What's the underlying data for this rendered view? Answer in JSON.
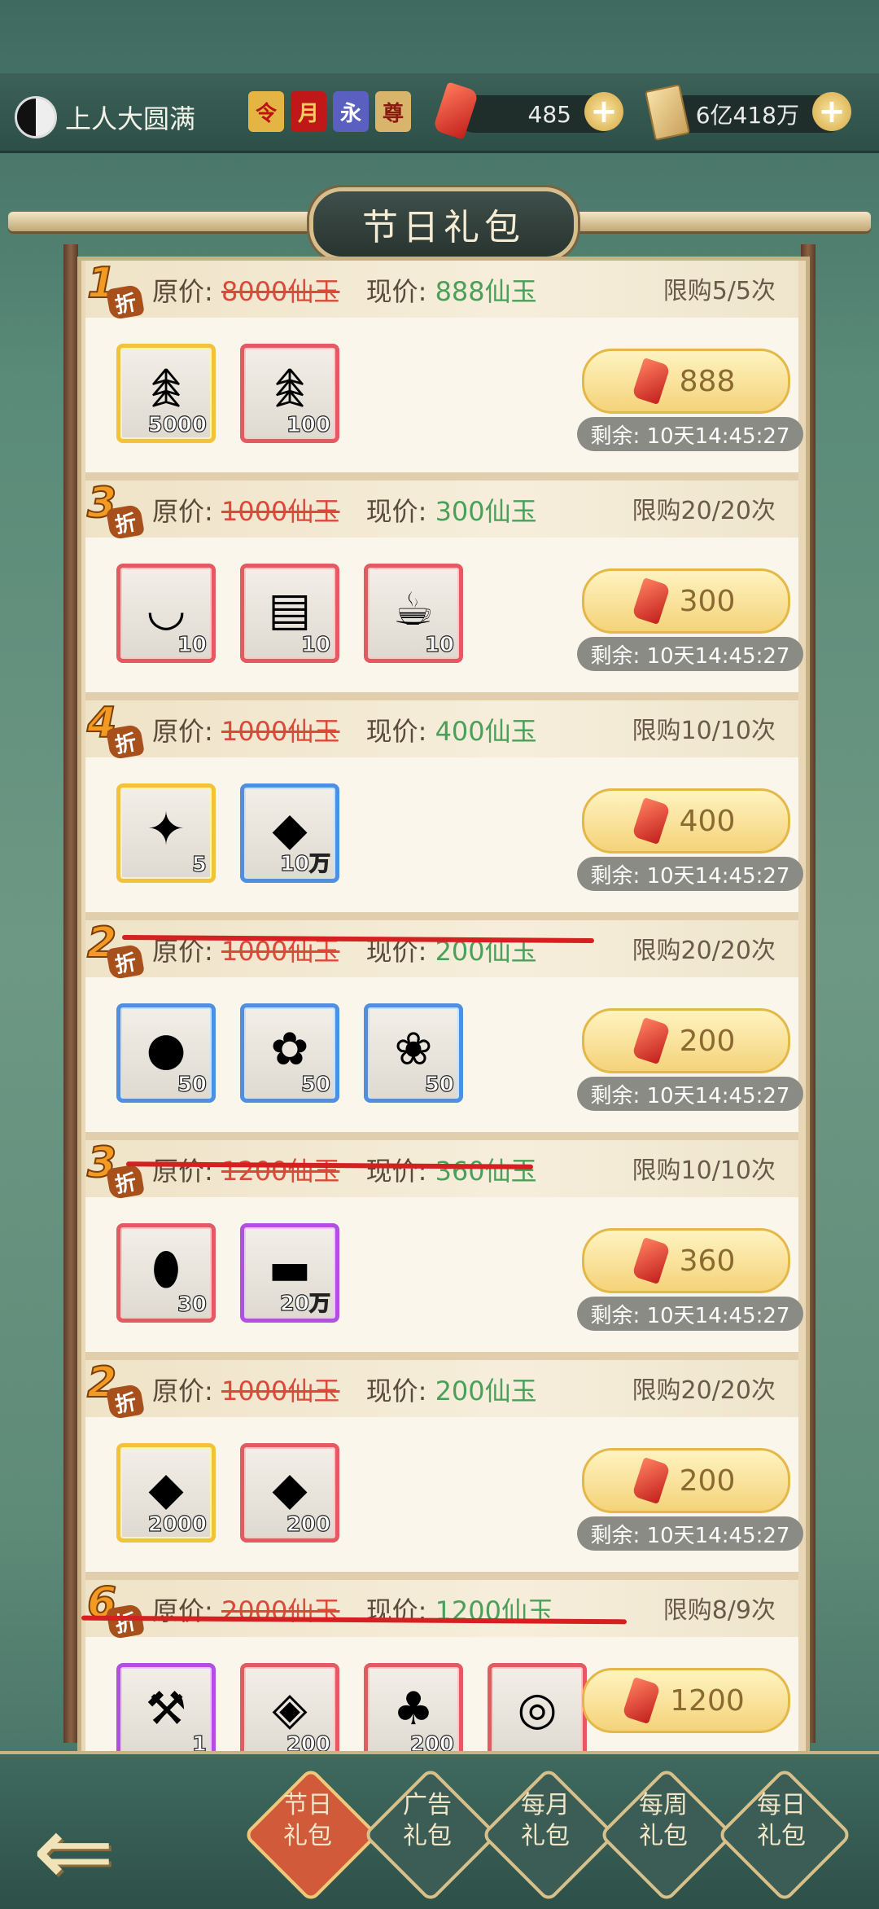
{
  "player": {
    "name": "上人大圆满"
  },
  "badges": [
    "令",
    "月",
    "永",
    "尊"
  ],
  "currencies": [
    {
      "name": "gem",
      "value": "485"
    },
    {
      "name": "token",
      "value": "6亿418万"
    }
  ],
  "title": "节日礼包",
  "labels": {
    "original": "原价:",
    "current": "现价:"
  },
  "gift_packs": [
    {
      "discount": "1",
      "zhe": "折",
      "original": "8000仙玉",
      "current": "888仙玉",
      "limit": "限购5/5次",
      "price": "888",
      "remaining": "剩余: 10天14:45:27",
      "items": [
        {
          "icon": "ginseng-icon",
          "qty": "5000",
          "frame": "gold",
          "glyph": "𖠰"
        },
        {
          "icon": "ginseng-icon",
          "qty": "100",
          "frame": "red",
          "glyph": "𖠰"
        }
      ]
    },
    {
      "discount": "3",
      "zhe": "折",
      "original": "1000仙玉",
      "current": "300仙玉",
      "limit": "限购20/20次",
      "price": "300",
      "remaining": "剩余: 10天14:45:27",
      "items": [
        {
          "icon": "bowl-icon",
          "qty": "10",
          "frame": "red",
          "glyph": "◡"
        },
        {
          "icon": "scroll-icon",
          "qty": "10",
          "frame": "red",
          "glyph": "▤"
        },
        {
          "icon": "tea-cup-icon",
          "qty": "10",
          "frame": "red",
          "glyph": "☕"
        }
      ]
    },
    {
      "discount": "4",
      "zhe": "折",
      "original": "1000仙玉",
      "current": "400仙玉",
      "limit": "限购10/10次",
      "price": "400",
      "remaining": "剩余: 10天14:45:27",
      "items": [
        {
          "icon": "ruby-key-icon",
          "qty": "5",
          "frame": "gold",
          "glyph": "✦"
        },
        {
          "icon": "jade-ingot-icon",
          "qty": "10万",
          "frame": "blue",
          "glyph": "◆"
        }
      ]
    },
    {
      "discount": "2",
      "zhe": "折",
      "original": "1000仙玉",
      "current": "200仙玉",
      "limit": "限购20/20次",
      "price": "200",
      "remaining": "剩余: 10天14:45:27",
      "items": [
        {
          "icon": "melon-icon",
          "qty": "50",
          "frame": "blue",
          "glyph": "●"
        },
        {
          "icon": "red-flower-icon",
          "qty": "50",
          "frame": "blue",
          "glyph": "✿"
        },
        {
          "icon": "herb-icon",
          "qty": "50",
          "frame": "blue",
          "glyph": "❀"
        }
      ]
    },
    {
      "discount": "3",
      "zhe": "折",
      "original": "1200仙玉",
      "current": "360仙玉",
      "limit": "限购10/10次",
      "price": "360",
      "remaining": "剩余: 10天14:45:27",
      "items": [
        {
          "icon": "pink-egg-icon",
          "qty": "30",
          "frame": "red",
          "glyph": "⬮"
        },
        {
          "icon": "talisman-icon",
          "qty": "20万",
          "frame": "purple",
          "glyph": "▬"
        }
      ]
    },
    {
      "discount": "2",
      "zhe": "折",
      "original": "1000仙玉",
      "current": "200仙玉",
      "limit": "限购20/20次",
      "price": "200",
      "remaining": "剩余: 10天14:45:27",
      "items": [
        {
          "icon": "jade-ingot-icon",
          "qty": "2000",
          "frame": "gold",
          "glyph": "◆"
        },
        {
          "icon": "jade-ingot-icon",
          "qty": "200",
          "frame": "red",
          "glyph": "◆"
        }
      ]
    },
    {
      "discount": "6",
      "zhe": "折",
      "original": "2000仙玉",
      "current": "1200仙玉",
      "limit": "限购8/9次",
      "price": "1200",
      "remaining": "",
      "items": [
        {
          "icon": "hammer-icon",
          "qty": "1",
          "frame": "purple",
          "glyph": "⚒"
        },
        {
          "icon": "crystal-ore-icon",
          "qty": "200",
          "frame": "red",
          "glyph": "◈"
        },
        {
          "icon": "treasure-bag-icon",
          "qty": "200",
          "frame": "red",
          "glyph": "♣"
        },
        {
          "icon": "orb-icon",
          "qty": "",
          "frame": "red",
          "glyph": "◎"
        }
      ]
    }
  ],
  "tabs": [
    {
      "line1": "节日",
      "line2": "礼包",
      "active": true
    },
    {
      "line1": "广告",
      "line2": "礼包",
      "active": false
    },
    {
      "line1": "每月",
      "line2": "礼包",
      "active": false
    },
    {
      "line1": "每周",
      "line2": "礼包",
      "active": false
    },
    {
      "line1": "每日",
      "line2": "礼包",
      "active": false
    }
  ]
}
